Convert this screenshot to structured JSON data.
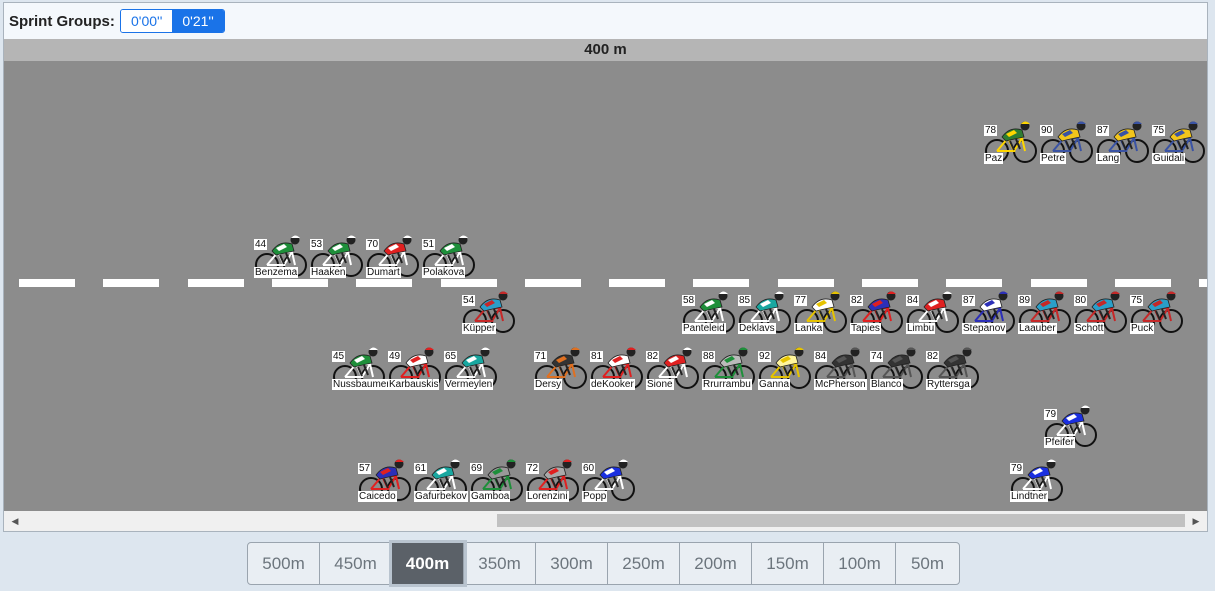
{
  "header": {
    "sprint_groups_label": "Sprint Groups:",
    "group_buttons": [
      {
        "label": "0'00''",
        "active": false
      },
      {
        "label": "0'21''",
        "active": true
      }
    ]
  },
  "distance_marker": "400 m",
  "riders": [
    {
      "num": "78",
      "name": "Paz",
      "jersey": "#2e7d32",
      "trim": "#ffd600"
    },
    {
      "num": "90",
      "name": "Petre",
      "jersey": "#f2c51b",
      "trim": "#3a53a4"
    },
    {
      "num": "87",
      "name": "Lang",
      "jersey": "#f2c51b",
      "trim": "#3a53a4"
    },
    {
      "num": "75",
      "name": "Guidali",
      "jersey": "#f2c51b",
      "trim": "#3a53a4"
    },
    {
      "num": "44",
      "name": "Benzema",
      "jersey": "#1e8f3a",
      "trim": "#ffffff"
    },
    {
      "num": "53",
      "name": "Haaken",
      "jersey": "#1e8f3a",
      "trim": "#ffffff"
    },
    {
      "num": "70",
      "name": "Dumart",
      "jersey": "#e02020",
      "trim": "#ffffff"
    },
    {
      "num": "51",
      "name": "Polakova",
      "jersey": "#1e8f3a",
      "trim": "#ffffff"
    },
    {
      "num": "54",
      "name": "Küpper",
      "jersey": "#2a9fc9",
      "trim": "#c62828"
    },
    {
      "num": "58",
      "name": "Panteleid",
      "jersey": "#1e8f3a",
      "trim": "#ffffff"
    },
    {
      "num": "85",
      "name": "Deklavs",
      "jersey": "#18a7a0",
      "trim": "#ffffff"
    },
    {
      "num": "77",
      "name": "Lanka",
      "jersey": "#ffffff",
      "trim": "#e6c300"
    },
    {
      "num": "82",
      "name": "Tapies",
      "jersey": "#2c2fb8",
      "trim": "#e02020"
    },
    {
      "num": "84",
      "name": "Limbu",
      "jersey": "#e02020",
      "trim": "#ffffff"
    },
    {
      "num": "87",
      "name": "Stepanov",
      "jersey": "#ffffff",
      "trim": "#2c2fb8"
    },
    {
      "num": "89",
      "name": "Laauber",
      "jersey": "#2a9fc9",
      "trim": "#c62828"
    },
    {
      "num": "80",
      "name": "Schott",
      "jersey": "#2a9fc9",
      "trim": "#c62828"
    },
    {
      "num": "75",
      "name": "Puck",
      "jersey": "#2a9fc9",
      "trim": "#c62828"
    },
    {
      "num": "45",
      "name": "Nussbaumer",
      "jersey": "#1e8f3a",
      "trim": "#ffffff"
    },
    {
      "num": "49",
      "name": "Karbauskis",
      "jersey": "#ffffff",
      "trim": "#e02020"
    },
    {
      "num": "65",
      "name": "Vermeylen",
      "jersey": "#18a7a0",
      "trim": "#ffffff"
    },
    {
      "num": "71",
      "name": "Dersy",
      "jersey": "#333333",
      "trim": "#e07020"
    },
    {
      "num": "81",
      "name": "deKooker",
      "jersey": "#ffffff",
      "trim": "#e02020"
    },
    {
      "num": "82",
      "name": "Sione",
      "jersey": "#e02020",
      "trim": "#ffffff"
    },
    {
      "num": "88",
      "name": "Rrurrambu",
      "jersey": "#bbbbbb",
      "trim": "#1e8f3a"
    },
    {
      "num": "92",
      "name": "Ganna",
      "jersey": "#fff59d",
      "trim": "#e6c300"
    },
    {
      "num": "84",
      "name": "McPherson",
      "jersey": "#333333",
      "trim": "#555555"
    },
    {
      "num": "74",
      "name": "Blanco",
      "jersey": "#333333",
      "trim": "#555555"
    },
    {
      "num": "82",
      "name": "Ryttersga",
      "jersey": "#333333",
      "trim": "#555555"
    },
    {
      "num": "79",
      "name": "Pfeifer",
      "jersey": "#1a2fe0",
      "trim": "#ffffff"
    },
    {
      "num": "57",
      "name": "Caicedo",
      "jersey": "#2c2fb8",
      "trim": "#e02020"
    },
    {
      "num": "61",
      "name": "Gafurbekov",
      "jersey": "#18a7a0",
      "trim": "#ffffff"
    },
    {
      "num": "69",
      "name": "Gamboa",
      "jersey": "#999999",
      "trim": "#1e8f3a"
    },
    {
      "num": "72",
      "name": "Lorenzini",
      "jersey": "#aaaaaa",
      "trim": "#e02020"
    },
    {
      "num": "60",
      "name": "Popp",
      "jersey": "#1a2fe0",
      "trim": "#ffffff"
    },
    {
      "num": "79",
      "name": "Lindtner",
      "jersey": "#1a2fe0",
      "trim": "#ffffff"
    }
  ],
  "distance_buttons": [
    {
      "label": "500m",
      "active": false
    },
    {
      "label": "450m",
      "active": false
    },
    {
      "label": "400m",
      "active": true
    },
    {
      "label": "350m",
      "active": false
    },
    {
      "label": "300m",
      "active": false
    },
    {
      "label": "250m",
      "active": false
    },
    {
      "label": "200m",
      "active": false
    },
    {
      "label": "150m",
      "active": false
    },
    {
      "label": "100m",
      "active": false
    },
    {
      "label": "50m",
      "active": false
    }
  ],
  "icons": {
    "scroll_left": "chevron-left-icon",
    "scroll_right": "chevron-right-icon"
  }
}
